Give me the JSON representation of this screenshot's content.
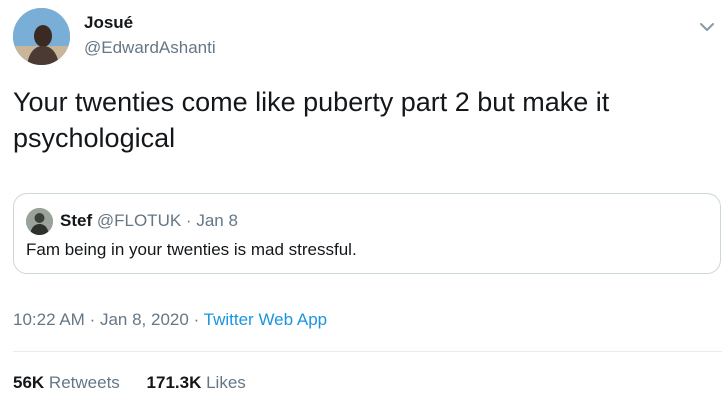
{
  "author": {
    "name": "Josué",
    "handle": "@EdwardAshanti"
  },
  "tweet": {
    "text": "Your twenties come like puberty part 2 but make it psychological"
  },
  "quoted_tweet": {
    "name": "Stef",
    "handle": "@FLOTUK",
    "separator": "·",
    "date": "Jan 8",
    "text": "Fam being in your twenties is mad stressful."
  },
  "meta": {
    "time": "10:22 AM",
    "separator": "·",
    "date": "Jan 8, 2020",
    "source": "Twitter Web App"
  },
  "stats": {
    "retweets_count": "56K",
    "retweets_label": "Retweets",
    "likes_count": "171.3K",
    "likes_label": "Likes"
  },
  "icons": {
    "more": "chevron-down-icon"
  },
  "colors": {
    "text": "#14171a",
    "secondary": "#657786",
    "link": "#1b95e0",
    "border": "#ccd6dd"
  }
}
